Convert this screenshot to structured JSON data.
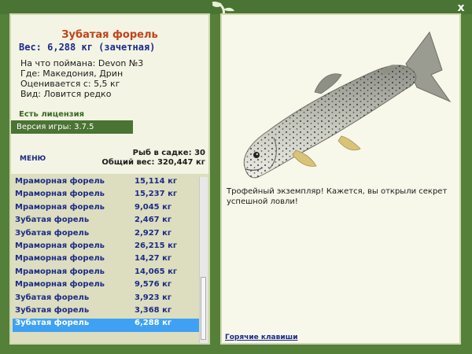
{
  "window": {
    "close_label": "x"
  },
  "fish": {
    "name": "Зубатая форель",
    "weight_line": "Вес: 6,288 кг (зачетная)",
    "info": [
      "На что поймана: Devon №3",
      "Где: Македония, Дрин",
      "Оценивается с: 5,5 кг",
      "Вид: Ловится редко"
    ]
  },
  "license_text": "Есть лицензия",
  "version_text": "Версия игры: 3.7.5",
  "menu_label": "МЕНЮ",
  "stats": {
    "count_line": "Рыб в садке: 30",
    "total_line": "Общий вес: 320,447 кг"
  },
  "catch_list": [
    {
      "name": "Мраморная форель",
      "weight": "15,114 кг"
    },
    {
      "name": "Мраморная форель",
      "weight": "15,237 кг"
    },
    {
      "name": "Мраморная форель",
      "weight": "9,045 кг"
    },
    {
      "name": "Зубатая форель",
      "weight": "2,467 кг"
    },
    {
      "name": "Зубатая форель",
      "weight": "2,927 кг"
    },
    {
      "name": "Мраморная форель",
      "weight": "26,215 кг"
    },
    {
      "name": "Мраморная форель",
      "weight": "14,27 кг"
    },
    {
      "name": "Мраморная форель",
      "weight": "14,065 кг"
    },
    {
      "name": "Мраморная форель",
      "weight": "9,576 кг"
    },
    {
      "name": "Зубатая форель",
      "weight": "3,923 кг"
    },
    {
      "name": "Зубатая форель",
      "weight": "3,368 кг"
    },
    {
      "name": "Зубатая форель",
      "weight": "6,288 кг",
      "selected": true
    }
  ],
  "message": "Трофейный экземпляр! Кажется, вы открыли секрет успешной ловли!",
  "hotkeys_label": "Горячие клавиши",
  "colors": {
    "frame": "#54803a",
    "panel": "#f4f4e4",
    "title": "#c0441a",
    "accent_text": "#1c2a8a",
    "selection": "#3fa1f3"
  },
  "icons": {
    "close": "close-icon",
    "ornament": "fish-ornament-icon"
  }
}
